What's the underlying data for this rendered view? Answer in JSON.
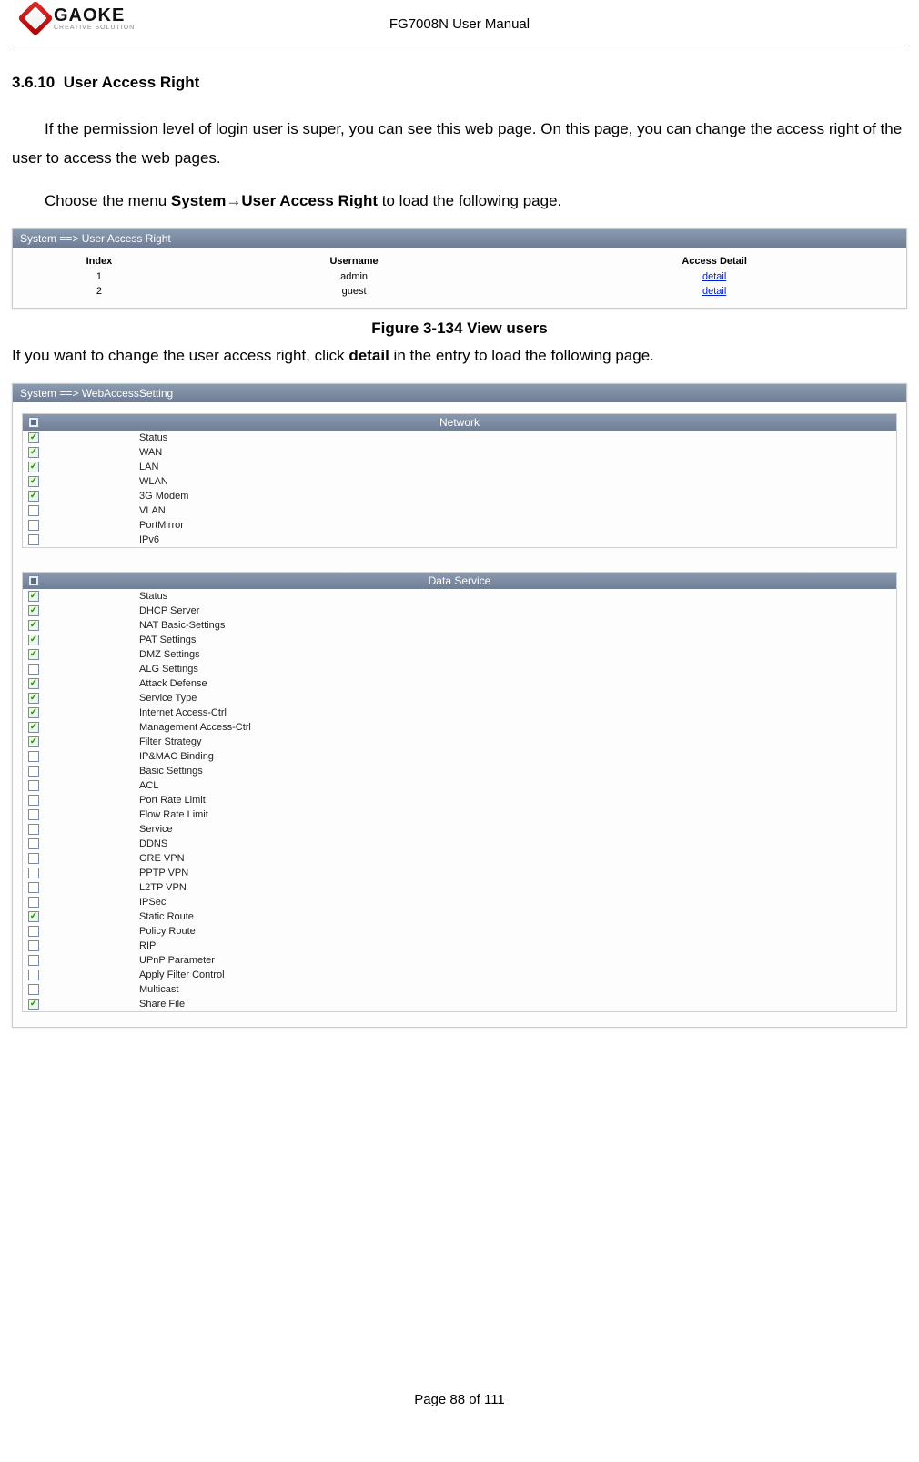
{
  "header": {
    "manual_title": "FG7008N User Manual",
    "logo_main": "GAOKE",
    "logo_sub": "CREATIVE SOLUTION"
  },
  "section": {
    "number": "3.6.10",
    "title": "User Access Right"
  },
  "paragraphs": {
    "p1": "If the permission level of login user is super, you can see this web page. On this page, you can change the access right of the user to access the web pages.",
    "p2_pre": "Choose the menu ",
    "p2_path": "System→User Access Right",
    "p2_post": " to load the following page.",
    "fig_caption": "Figure 3-134  View users",
    "p3_pre": "If you want to change the user access right, click ",
    "p3_bold": "detail",
    "p3_post": " in the entry to load the following page."
  },
  "panel_users": {
    "crumb": "System ==> User Access Right",
    "headers": {
      "c1": "Index",
      "c2": "Username",
      "c3": "Access Detail"
    },
    "rows": [
      {
        "index": "1",
        "username": "admin",
        "detail": "detail"
      },
      {
        "index": "2",
        "username": "guest",
        "detail": "detail"
      }
    ]
  },
  "panel_access": {
    "crumb": "System ==> WebAccessSetting",
    "sections": [
      {
        "title": "Network",
        "header_state": "indeterminate",
        "items": [
          {
            "label": "Status",
            "checked": true
          },
          {
            "label": "WAN",
            "checked": true
          },
          {
            "label": "LAN",
            "checked": true
          },
          {
            "label": "WLAN",
            "checked": true
          },
          {
            "label": "3G Modem",
            "checked": true
          },
          {
            "label": "VLAN",
            "checked": false
          },
          {
            "label": "PortMirror",
            "checked": false
          },
          {
            "label": "IPv6",
            "checked": false
          }
        ]
      },
      {
        "title": "Data Service",
        "header_state": "indeterminate",
        "items": [
          {
            "label": "Status",
            "checked": true
          },
          {
            "label": "DHCP Server",
            "checked": true
          },
          {
            "label": "NAT Basic-Settings",
            "checked": true
          },
          {
            "label": "PAT Settings",
            "checked": true
          },
          {
            "label": "DMZ Settings",
            "checked": true
          },
          {
            "label": "ALG Settings",
            "checked": false
          },
          {
            "label": "Attack Defense",
            "checked": true
          },
          {
            "label": "Service Type",
            "checked": true
          },
          {
            "label": "Internet Access-Ctrl",
            "checked": true
          },
          {
            "label": "Management Access-Ctrl",
            "checked": true
          },
          {
            "label": "Filter Strategy",
            "checked": true
          },
          {
            "label": "IP&MAC Binding",
            "checked": false
          },
          {
            "label": "Basic Settings",
            "checked": false
          },
          {
            "label": "ACL",
            "checked": false
          },
          {
            "label": "Port Rate Limit",
            "checked": false
          },
          {
            "label": "Flow Rate Limit",
            "checked": false
          },
          {
            "label": "Service",
            "checked": false
          },
          {
            "label": "DDNS",
            "checked": false
          },
          {
            "label": "GRE VPN",
            "checked": false
          },
          {
            "label": "PPTP VPN",
            "checked": false
          },
          {
            "label": "L2TP VPN",
            "checked": false
          },
          {
            "label": "IPSec",
            "checked": false
          },
          {
            "label": "Static Route",
            "checked": true
          },
          {
            "label": "Policy Route",
            "checked": false
          },
          {
            "label": "RIP",
            "checked": false
          },
          {
            "label": "UPnP Parameter",
            "checked": false
          },
          {
            "label": "Apply Filter Control",
            "checked": false
          },
          {
            "label": "Multicast",
            "checked": false
          },
          {
            "label": "Share File",
            "checked": true
          }
        ]
      }
    ]
  },
  "footer": {
    "page_of": "Page 88 of 111"
  }
}
